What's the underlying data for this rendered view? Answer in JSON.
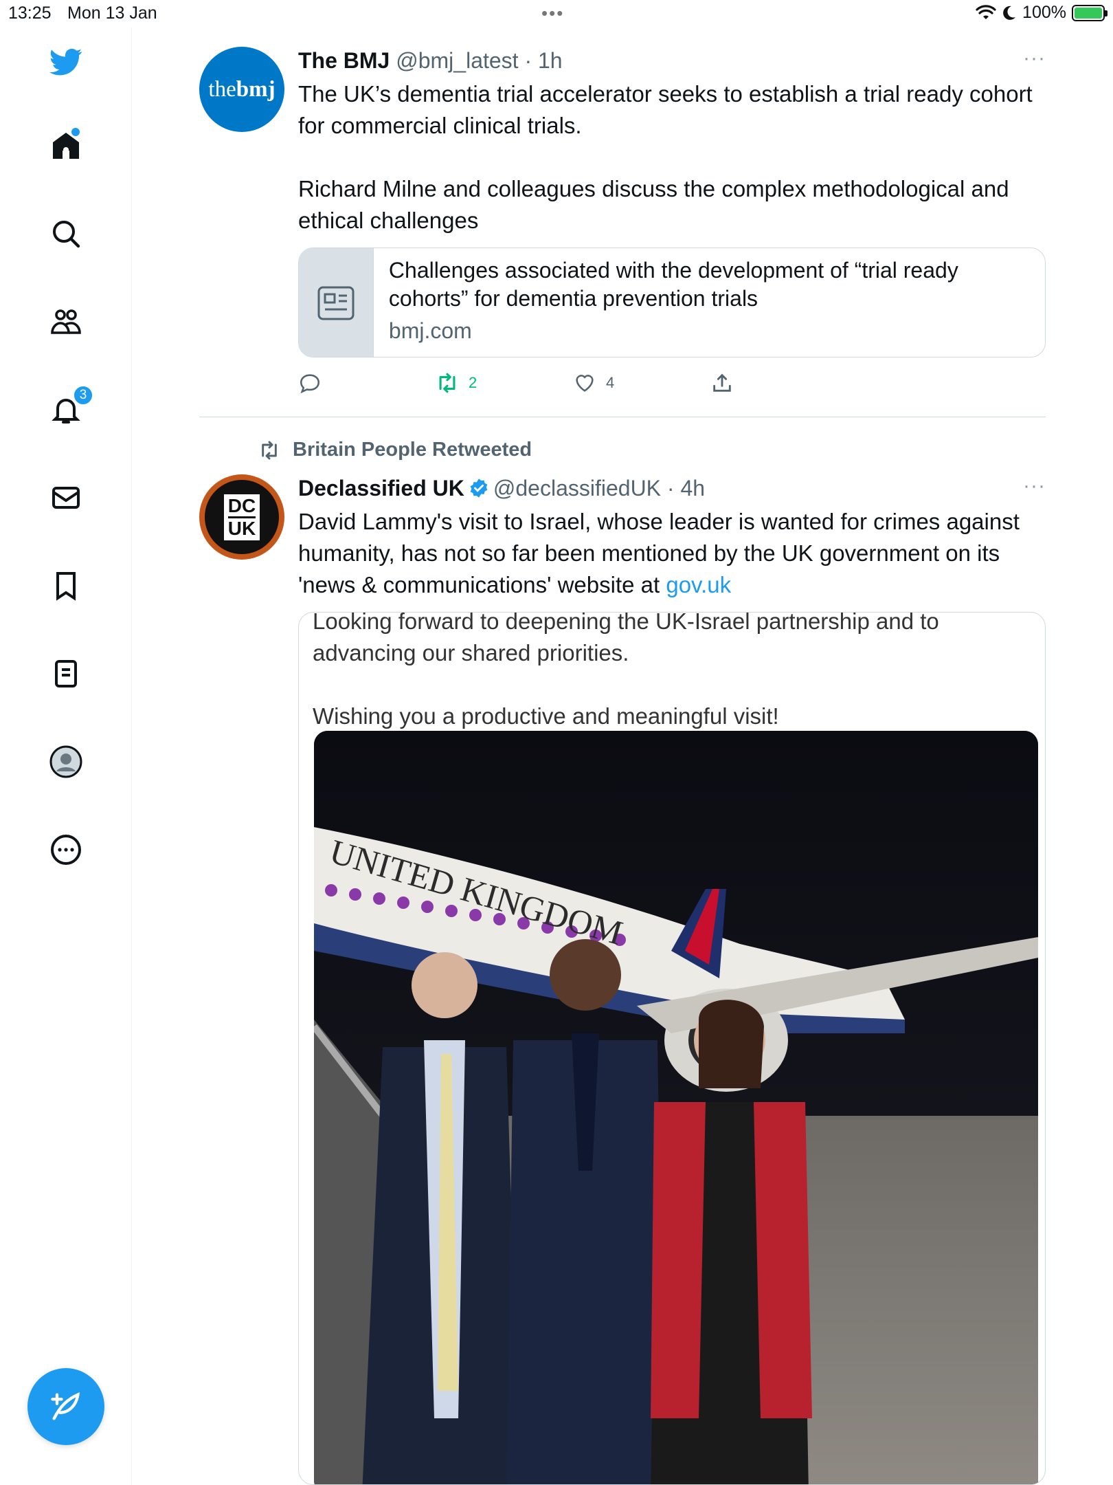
{
  "status_bar": {
    "time": "13:25",
    "date": "Mon 13 Jan",
    "dots": "•••",
    "battery": "100%"
  },
  "sidebar": {
    "notifications_badge": "3",
    "items": [
      "Home",
      "Search",
      "Communities",
      "Notifications",
      "Messages",
      "Bookmarks",
      "Lists",
      "Profile",
      "More"
    ]
  },
  "tweets": [
    {
      "name": "The BMJ",
      "handle": "@bmj_latest",
      "time": "· 1h",
      "avatar_text": {
        "a": "the",
        "b": "bmj"
      },
      "text": "The UK’s dementia trial accelerator seeks to establish a trial ready cohort for commercial clinical trials.\n\nRichard Milne and colleagues discuss the complex methodological and ethical challenges",
      "card": {
        "title": "Challenges associated with the development of “trial ready cohorts” for dementia prevention trials",
        "domain": "bmj.com"
      },
      "retweets": "2",
      "likes": "4"
    },
    {
      "retweeted_by": "Britain People Retweeted",
      "name": "Declassified UK",
      "handle": "@declassifiedUK",
      "time": "· 4h",
      "avatar_text": {
        "a": "DC",
        "b": "UK"
      },
      "text": "David Lammy's visit to Israel, whose leader is wanted for crimes against humanity, has not so far been mentioned by the UK government on its 'news & communications' website at ",
      "link": "gov.uk",
      "quote": {
        "text": "Looking forward to deepening the UK-Israel partnership and to advancing our shared priorities.\n\nWishing you a productive and meaningful visit!"
      },
      "photo": {
        "aircraft_text": "UNITED KINGDOM"
      }
    }
  ],
  "more": "···",
  "colors": {
    "accent": "#1d9bf0",
    "retweet": "#00ba7c",
    "text": "#0f1419",
    "muted": "#536471"
  }
}
